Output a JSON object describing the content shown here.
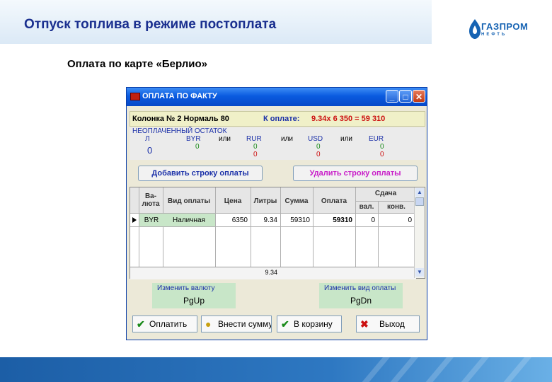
{
  "slide": {
    "title": "Отпуск топлива в режиме постоплата",
    "subtitle": "Оплата по карте «Берлио»",
    "logo_brand": "ГАЗПРОМ",
    "logo_sub": "НЕФТЬ"
  },
  "window": {
    "title": "ОПЛАТА ПО ФАКТУ",
    "controls": [
      "_",
      "□",
      "✕"
    ],
    "column_info": "Колонка № 2 Нормаль 80",
    "to_pay_label": "К оплате:",
    "to_pay_calc": "9.34x  6 350 =   59 310"
  },
  "unpaid": {
    "label": "НЕОПЛАЧЕННЫЙ ОСТАТОК",
    "l_label": "Л",
    "l_value": "0",
    "byr_label": "BYR",
    "byr_value": "0",
    "or": "или",
    "rur_label": "RUR",
    "rur_values": [
      "0",
      "0"
    ],
    "usd_label": "USD",
    "usd_values": [
      "0",
      "0"
    ],
    "eur_label": "EUR",
    "eur_values": [
      "0",
      "0"
    ]
  },
  "actions": {
    "add_row": "Добавить строку оплаты",
    "delete_row": "Удалить строку оплаты"
  },
  "grid": {
    "headers": {
      "currency": [
        "Ва-",
        "люта"
      ],
      "payment_type": "Вид оплаты",
      "price": "Цена",
      "liters": "Литры",
      "sum": "Сумма",
      "payment": "Оплата",
      "change": "Сдача",
      "change_val": "вал.",
      "change_conv": "конв."
    },
    "rows": [
      {
        "currency": "BYR",
        "type": "Наличная",
        "price": "6350",
        "liters": "9.34",
        "sum": "59310",
        "payment": "59310",
        "val": "0",
        "conv": "0"
      }
    ],
    "total_liters": "9.34"
  },
  "keys": {
    "change_currency_label": "Изменить валюту",
    "change_currency_key": "PgUp",
    "change_payment_label": "Изменить вид оплаты",
    "change_payment_key": "PgDn"
  },
  "buttons": {
    "pay": "Оплатить",
    "enter_sum": "Внести сумму",
    "to_cart": "В корзину",
    "exit": "Выход"
  },
  "colors": {
    "title_blue": "#1a2f8f",
    "label_blue": "#1a2fa8",
    "value_green": "#1a8a1a",
    "value_red": "#cc1010",
    "key_box_green": "#c8e6c8"
  }
}
